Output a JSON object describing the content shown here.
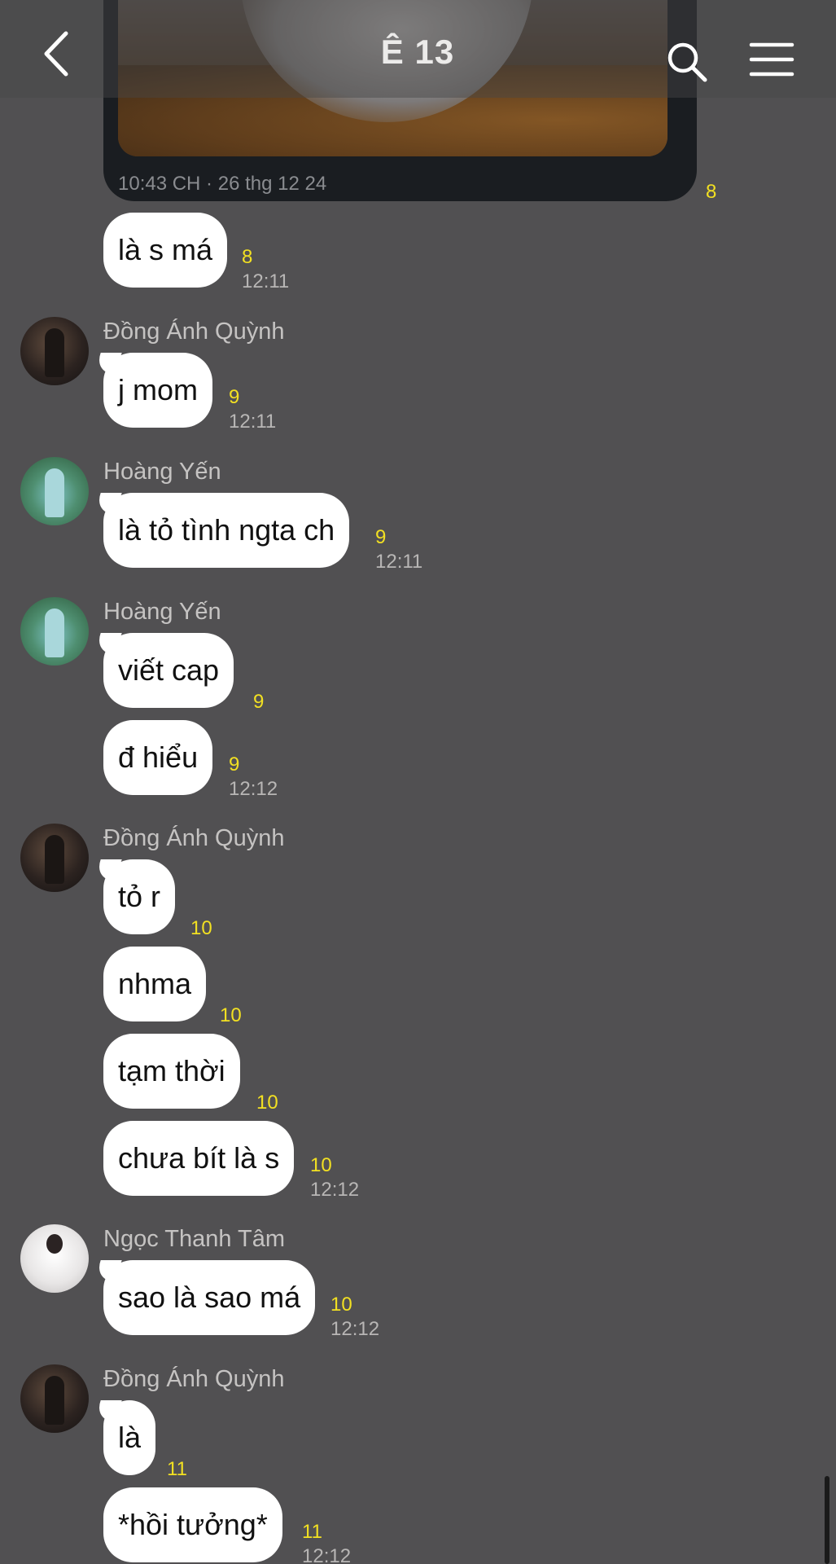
{
  "header": {
    "title": "Ê 13",
    "back_icon": "chevron-left-icon",
    "search_icon": "search-icon",
    "menu_icon": "hamburger-menu-icon"
  },
  "media": {
    "meta": "10:43 CH · 26 thg 12 24",
    "count": "8"
  },
  "messages": [
    {
      "sender": "",
      "text": "là s má",
      "count": "8",
      "time": "12:11"
    },
    {
      "sender": "Đồng Ánh Quỳnh",
      "text": "j mom",
      "count": "9",
      "time": "12:11"
    },
    {
      "sender": "Hoàng Yến",
      "text": "là tỏ tình ngta ch",
      "count": "9",
      "time": "12:11"
    },
    {
      "sender": "Hoàng Yến",
      "text": "viết cap",
      "count": "9",
      "time": ""
    },
    {
      "sender": "",
      "text": "đ hiểu",
      "count": "9",
      "time": "12:12"
    },
    {
      "sender": "Đồng Ánh Quỳnh",
      "text": "tỏ r",
      "count": "10",
      "time": ""
    },
    {
      "sender": "",
      "text": "nhma",
      "count": "10",
      "time": ""
    },
    {
      "sender": "",
      "text": "tạm thời",
      "count": "10",
      "time": ""
    },
    {
      "sender": "",
      "text": "chưa bít là s",
      "count": "10",
      "time": "12:12"
    },
    {
      "sender": "Ngọc Thanh Tâm",
      "text": "sao là sao má",
      "count": "10",
      "time": "12:12"
    },
    {
      "sender": "Đồng Ánh Quỳnh",
      "text": "là",
      "count": "11",
      "time": ""
    },
    {
      "sender": "",
      "text": "*hồi tưởng*",
      "count": "11",
      "time": "12:12"
    }
  ],
  "colors": {
    "background": "#515052",
    "bubble": "#ffffff",
    "read_count": "#f2e022",
    "timestamp": "#b8b6b5"
  }
}
